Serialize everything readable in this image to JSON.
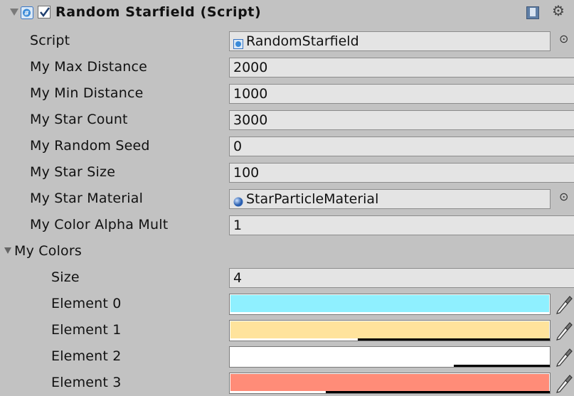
{
  "header": {
    "title": "Random Starfield (Script)",
    "enabled": true
  },
  "fields": [
    {
      "label": "Script",
      "value": "RandomStarfield",
      "kind": "object-script"
    },
    {
      "label": "My Max Distance",
      "value": "2000",
      "kind": "number"
    },
    {
      "label": "My Min Distance",
      "value": "1000",
      "kind": "number"
    },
    {
      "label": "My Star Count",
      "value": "3000",
      "kind": "number"
    },
    {
      "label": "My Random Seed",
      "value": "0",
      "kind": "number"
    },
    {
      "label": "My Star Size",
      "value": "100",
      "kind": "number"
    },
    {
      "label": "My Star Material",
      "value": "StarParticleMaterial",
      "kind": "object-material"
    },
    {
      "label": "My Color Alpha Mult",
      "value": "1",
      "kind": "number"
    }
  ],
  "colors": {
    "label": "My Colors",
    "size_label": "Size",
    "size_value": "4",
    "elements": [
      {
        "label": "Element 0",
        "color": "#8ff0ff",
        "alpha": 1.0
      },
      {
        "label": "Element 1",
        "color": "#ffe39c",
        "alpha": 0.4
      },
      {
        "label": "Element 2",
        "color": "#ffffff",
        "alpha": 0.7
      },
      {
        "label": "Element 3",
        "color": "#ff8c78",
        "alpha": 0.3
      }
    ]
  }
}
